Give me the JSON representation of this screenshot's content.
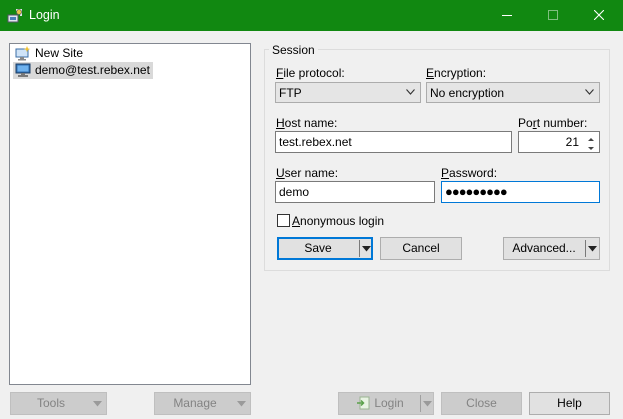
{
  "window": {
    "title": "Login",
    "minimize_label": "Minimize",
    "maximize_label": "Maximize",
    "close_label": "Close"
  },
  "sites": [
    {
      "label": "New Site",
      "icon": "new-site-icon"
    },
    {
      "label": "demo@test.rebex.net",
      "icon": "site-computer-icon",
      "selected": true
    }
  ],
  "session": {
    "group_title": "Session",
    "file_protocol": {
      "label_u": "F",
      "label_rest": "ile protocol:",
      "value": "FTP"
    },
    "encryption": {
      "label_u": "E",
      "label_rest": "ncryption:",
      "value": "No encryption"
    },
    "host_name": {
      "label_u": "H",
      "label_rest": "ost name:",
      "value": "test.rebex.net"
    },
    "port_number": {
      "label_u": "r",
      "label_pre": "Po",
      "label_rest": "t number:",
      "value": "21"
    },
    "user_name": {
      "label_u": "U",
      "label_rest": "ser name:",
      "value": "demo"
    },
    "password": {
      "label_u": "P",
      "label_rest": "assword:",
      "value": "●●●●●●●●●"
    },
    "anonymous": {
      "label_u": "A",
      "label_rest": "nonymous login",
      "checked": false
    }
  },
  "buttons": {
    "save": "Save",
    "cancel": "Cancel",
    "advanced": "Advanced...",
    "tools": "Tools",
    "manage": "Manage",
    "login": "Login",
    "close": "Close",
    "help": "Help"
  },
  "colors": {
    "titlebar": "#118811",
    "focus": "#0078d7"
  }
}
